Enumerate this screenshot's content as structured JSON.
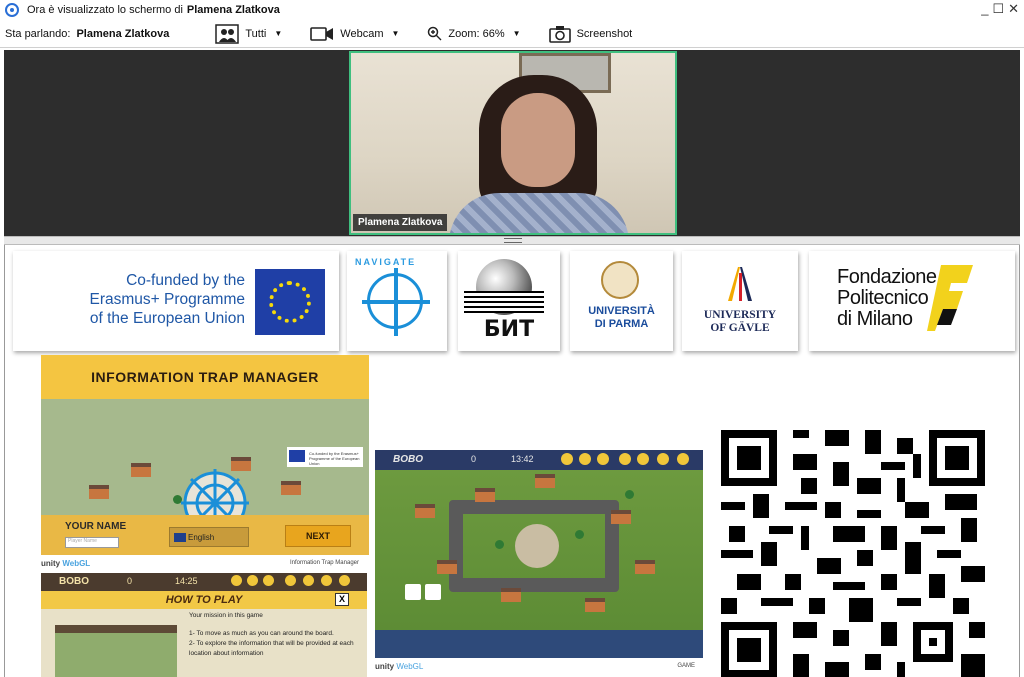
{
  "window": {
    "title_prefix": "Ora è visualizzato lo schermo di",
    "presenter": "Plamena Zlatkova",
    "controls": [
      "_",
      "☐",
      "✕"
    ]
  },
  "toolbar": {
    "speaking_label": "Sta parlando:",
    "speaker_name": "Plamena Zlatkova",
    "view_label": "Tutti",
    "webcam_label": "Webcam",
    "zoom_label": "Zoom: 66%",
    "screenshot_label": "Screenshot"
  },
  "video": {
    "participant_name": "Plamena Zlatkova",
    "active_border_color": "#3fbf7f"
  },
  "logos": {
    "erasmus_text": [
      "Co-funded by the",
      "Erasmus+ Programme",
      "of the European Union"
    ],
    "navigate_text": "NAVIGATE",
    "bit_text": "БИТ",
    "parma_text": [
      "UNIVERSITÀ",
      "DI PARMA"
    ],
    "gavle_text": [
      "UNIVERSITY",
      "OF GÄVLE"
    ],
    "polimi_text": [
      "Fondazione",
      "Politecnico",
      "di Milano"
    ]
  },
  "game_main": {
    "title": "INFORMATION TRAP MANAGER",
    "your_name_label": "YOUR NAME",
    "name_placeholder": "Player Name",
    "language": "English",
    "next_label": "NEXT",
    "footer_brand": "unity",
    "footer_webgl": "WebGL",
    "footer_right": "Information Trap Manager",
    "eu_mini_text": "Co-funded by the Erasmus+ Programme of the European Union"
  },
  "game_bottom": {
    "player": "BOBO",
    "score": "0",
    "time": "14:25",
    "heading": "HOW TO PLAY",
    "close": "X",
    "mission_title": "Your mission in this game",
    "step1": "1- To move as much as you can around the board.",
    "step2": "2- To explore the information that will be provided at each location about information"
  },
  "game_center": {
    "player": "BOBO",
    "score": "0",
    "time": "13:42",
    "footer_brand": "unity",
    "footer_webgl": "WebGL",
    "footer_right": "GAME"
  }
}
